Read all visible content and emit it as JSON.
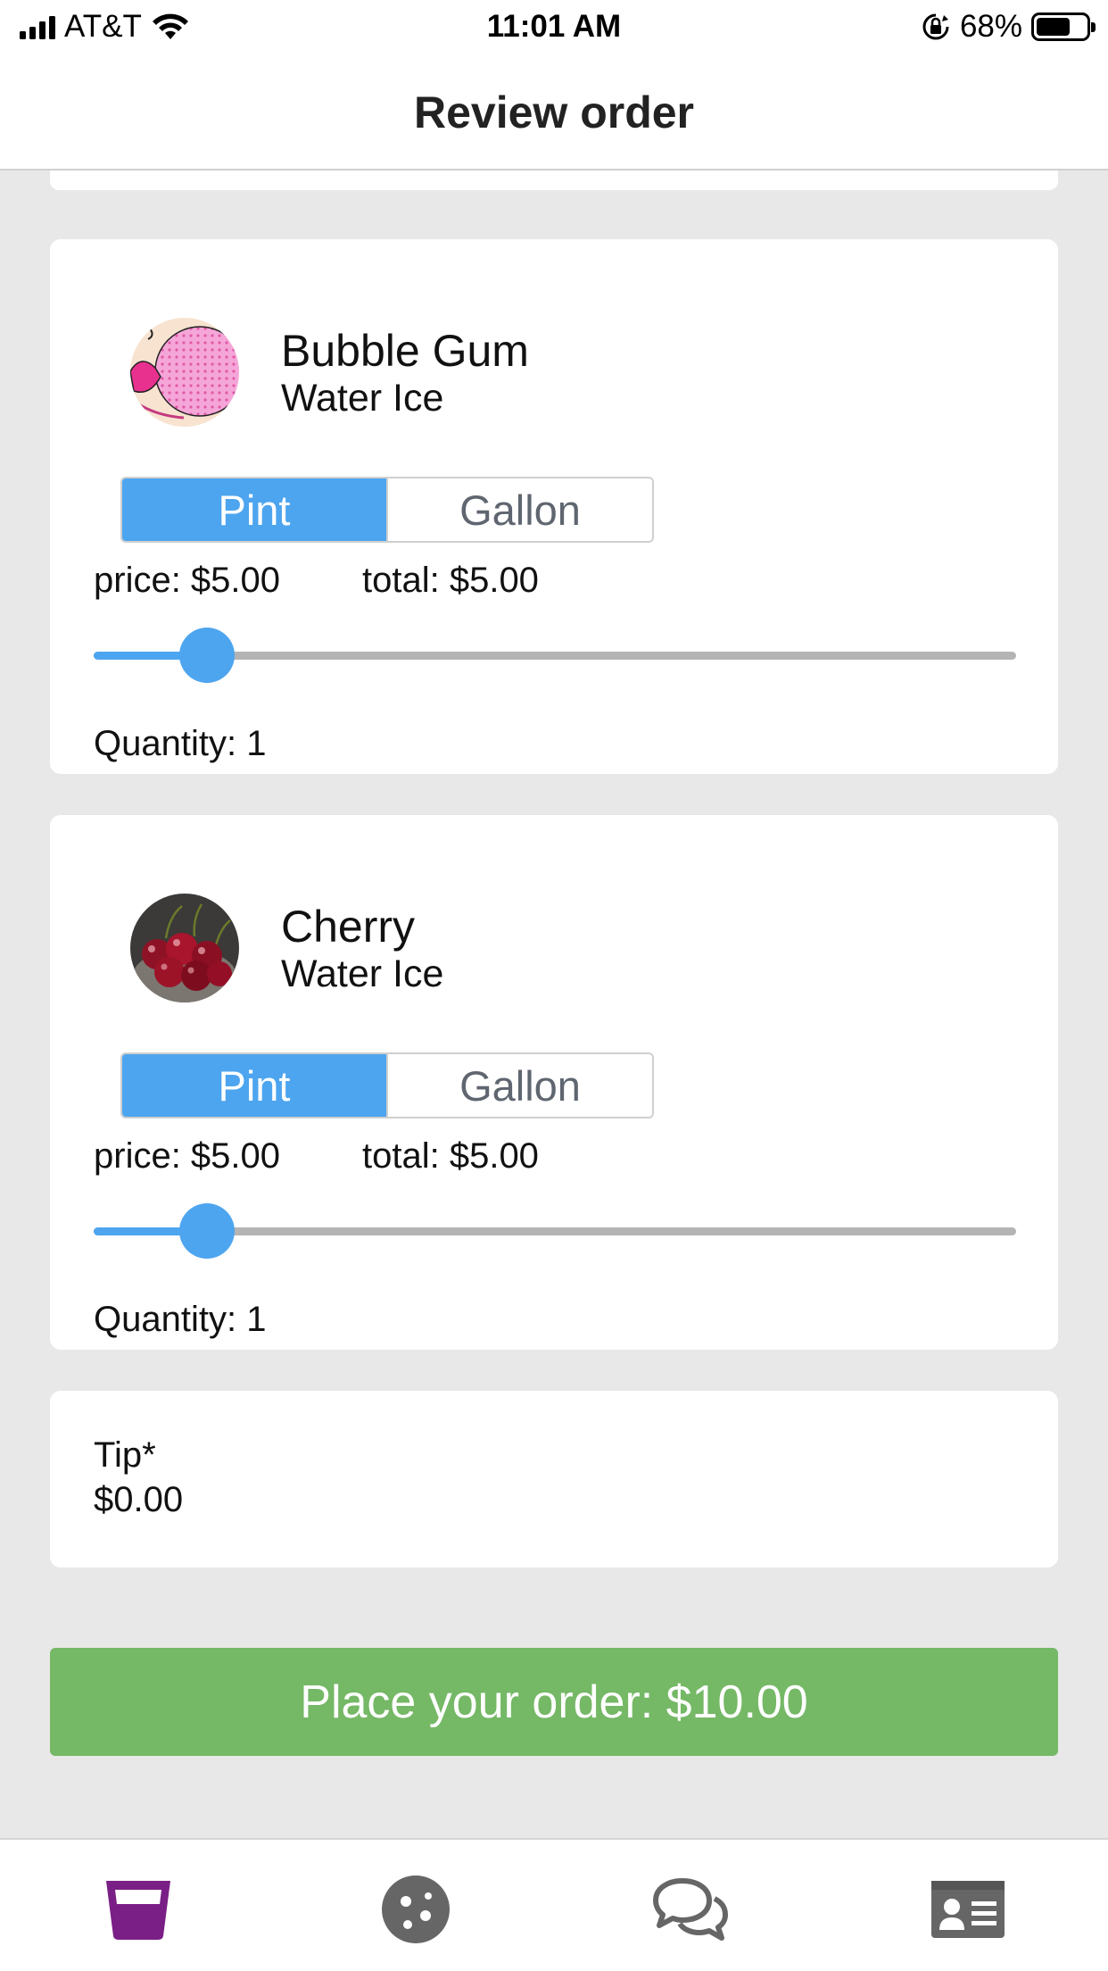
{
  "status_bar": {
    "carrier": "AT&T",
    "time": "11:01 AM",
    "battery": "68%",
    "battery_level": 0.68
  },
  "header": {
    "title": "Review order"
  },
  "items": [
    {
      "name": "Bubble Gum",
      "type": "Water Ice",
      "image": "bubble-gum-thumbnail",
      "sizes": [
        "Pint",
        "Gallon"
      ],
      "selected_size": "Pint",
      "price": "price: $5.00",
      "total": "total: $5.00",
      "quantity_label": "Quantity: 1",
      "quantity": 1,
      "slider_level": 0.123
    },
    {
      "name": "Cherry",
      "type": "Water Ice",
      "image": "cherry-thumbnail",
      "sizes": [
        "Pint",
        "Gallon"
      ],
      "selected_size": "Pint",
      "price": "price: $5.00",
      "total": "total: $5.00",
      "quantity_label": "Quantity: 1",
      "quantity": 1,
      "slider_level": 0.123
    }
  ],
  "tip": {
    "label": "Tip*",
    "value": "$0.00"
  },
  "order_button": {
    "label": "Place your order: $10.00"
  },
  "tab_bar": {
    "tabs": [
      {
        "icon": "cup-icon",
        "active": true
      },
      {
        "icon": "cookie-icon",
        "active": false
      },
      {
        "icon": "chat-bubbles-icon",
        "active": false
      },
      {
        "icon": "id-card-icon",
        "active": false
      }
    ]
  },
  "colors": {
    "accent_blue": "#4da5ef",
    "order_green": "#75b866",
    "active_tab_purple": "#7a1f86",
    "inactive_tab_gray": "#666666"
  }
}
